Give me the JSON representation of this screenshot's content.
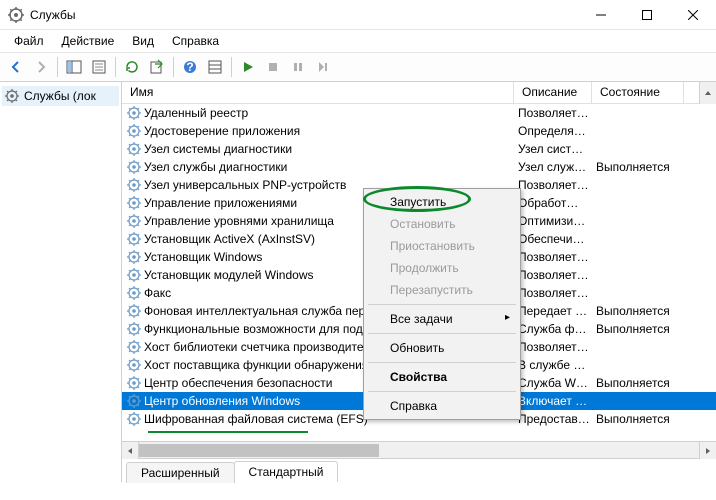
{
  "title": "Службы",
  "menu": {
    "file": "Файл",
    "action": "Действие",
    "view": "Вид",
    "help": "Справка"
  },
  "tree_root": "Службы (лок",
  "columns": {
    "name": "Имя",
    "desc": "Описание",
    "state": "Состояние"
  },
  "services": [
    {
      "name": "Удаленный реестр",
      "desc": "Позволяет…",
      "state": ""
    },
    {
      "name": "Удостоверение приложения",
      "desc": "Определя…",
      "state": ""
    },
    {
      "name": "Узел системы диагностики",
      "desc": "Узел сист…",
      "state": ""
    },
    {
      "name": "Узел службы диагностики",
      "desc": "Узел служ…",
      "state": "Выполняется"
    },
    {
      "name": "Узел универсальных PNP-устройств",
      "desc": "Позволяет…",
      "state": ""
    },
    {
      "name": "Управление приложениями",
      "desc": "Обработ…",
      "state": ""
    },
    {
      "name": "Управление уровнями хранилища",
      "desc": "Оптимизи…",
      "state": ""
    },
    {
      "name": "Установщик ActiveX (AxInstSV)",
      "desc": "Обеспечи…",
      "state": ""
    },
    {
      "name": "Установщик Windows",
      "desc": "Позволяет…",
      "state": ""
    },
    {
      "name": "Установщик модулей Windows",
      "desc": "Позволяет…",
      "state": ""
    },
    {
      "name": "Факс",
      "desc": "Позволяет…",
      "state": ""
    },
    {
      "name": "Фоновая интеллектуальная служба пере",
      "desc": "Передает …",
      "state": "Выполняется"
    },
    {
      "name": "Функциональные возможности для подк",
      "desc": "Служба ф…",
      "state": "Выполняется"
    },
    {
      "name": "Хост библиотеки счетчика производите",
      "desc": "Позволяет…",
      "state": ""
    },
    {
      "name": "Хост поставщика функции обнаружения",
      "desc": "В службе …",
      "state": ""
    },
    {
      "name": "Центр обеспечения безопасности",
      "desc": "Служба W…",
      "state": "Выполняется"
    },
    {
      "name": "Центр обновления Windows",
      "desc": "Включает …",
      "state": "",
      "selected": true
    },
    {
      "name": "Шифрованная файловая система (EFS)",
      "desc": "Предостав…",
      "state": "Выполняется"
    }
  ],
  "ctx": {
    "start": "Запустить",
    "stop": "Остановить",
    "pause": "Приостановить",
    "resume": "Продолжить",
    "restart": "Перезапустить",
    "alltasks": "Все задачи",
    "refresh": "Обновить",
    "props": "Свойства",
    "help": "Справка"
  },
  "tabs": {
    "extended": "Расширенный",
    "standard": "Стандартный"
  }
}
